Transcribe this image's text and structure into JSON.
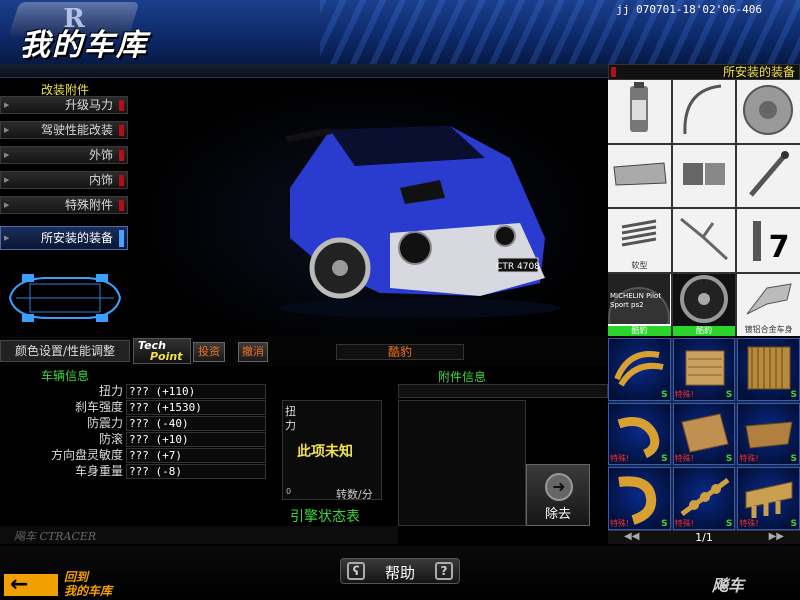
{
  "header": {
    "logo_letter": "R",
    "title": "我的车库",
    "clock": "jj 070701-18'02'06-406"
  },
  "left_menu": {
    "title": "改装附件",
    "items": [
      {
        "label": "升级马力"
      },
      {
        "label": "驾驶性能改装"
      },
      {
        "label": "外饰"
      },
      {
        "label": "内饰"
      },
      {
        "label": "特殊附件"
      },
      {
        "label": "所安装的装备",
        "active": true
      }
    ]
  },
  "car": {
    "plate": "CTR 4708",
    "body_color": "#2a3bd0",
    "accent_color": "#d8d8e0"
  },
  "installed": {
    "title": "所安装的装备",
    "parts": [
      {
        "icon": "brake-fluid-icon",
        "caption": ""
      },
      {
        "icon": "brake-line-icon",
        "caption": ""
      },
      {
        "icon": "brake-disc-icon",
        "caption": ""
      },
      {
        "icon": "brake-caliper-icon",
        "caption": ""
      },
      {
        "icon": "brake-pads-icon",
        "caption": ""
      },
      {
        "icon": "shock-absorber-icon",
        "caption": ""
      },
      {
        "icon": "spring-icon",
        "caption": "软型"
      },
      {
        "icon": "sway-bar-icon",
        "caption": ""
      },
      {
        "icon": "gear-7-icon",
        "caption": "7"
      },
      {
        "icon": "tire-icon",
        "caption": "MICHELIN Pilot Sport ps2",
        "tag": "酷豹"
      },
      {
        "icon": "wheel-icon",
        "caption": "",
        "tag": "酷豹"
      },
      {
        "icon": "control-arm-icon",
        "caption": "镀铝合金车身"
      }
    ]
  },
  "mid_bar": {
    "color_perf": "颜色设置/性能调整",
    "tech_line1": "Tech",
    "tech_line2": "Point",
    "invest": "投资",
    "cancel": "撤消",
    "car_name": "酷豹"
  },
  "vehicle_info": {
    "title": "车辆信息",
    "stats": [
      {
        "label": "扭力",
        "value": "??? (+110)"
      },
      {
        "label": "刹车强度",
        "value": "??? (+1530)"
      },
      {
        "label": "防震力",
        "value": "??? (-40)"
      },
      {
        "label": "防滚",
        "value": "??? (+10)"
      },
      {
        "label": "方向盘灵敏度",
        "value": "??? (+7)"
      },
      {
        "label": "车身重量",
        "value": "??? (-8)"
      }
    ]
  },
  "engine": {
    "axis_label": "扭力",
    "unknown_text": "此项未知",
    "zero": "0",
    "rpm_label": "转数/分",
    "state_label": "引擎状态表"
  },
  "accessory_info": {
    "title": "附件信息",
    "remove_label": "除去"
  },
  "inventory": {
    "items": [
      {
        "icon": "exhaust-manifold-icon",
        "special": "",
        "s": "S"
      },
      {
        "icon": "oil-cooler-icon",
        "special": "特殊!",
        "s": "S"
      },
      {
        "icon": "radiator-icon",
        "special": "",
        "s": "S"
      },
      {
        "icon": "intake-pipe-icon",
        "special": "特殊!",
        "s": "S"
      },
      {
        "icon": "intercooler-icon",
        "special": "特殊!",
        "s": "S"
      },
      {
        "icon": "oil-pan-icon",
        "special": "特殊!",
        "s": "S"
      },
      {
        "icon": "turbo-pipe-icon",
        "special": "特殊!",
        "s": "S"
      },
      {
        "icon": "camshaft-icon",
        "special": "特殊!",
        "s": "S"
      },
      {
        "icon": "intake-manifold-icon",
        "special": "特殊!",
        "s": "S"
      }
    ],
    "page": "1/1"
  },
  "footer": {
    "back_line1": "回到",
    "back_line2": "我的车库",
    "help": "帮助",
    "brand": "飚车",
    "brand_mini": "飚车 CTRACER"
  }
}
